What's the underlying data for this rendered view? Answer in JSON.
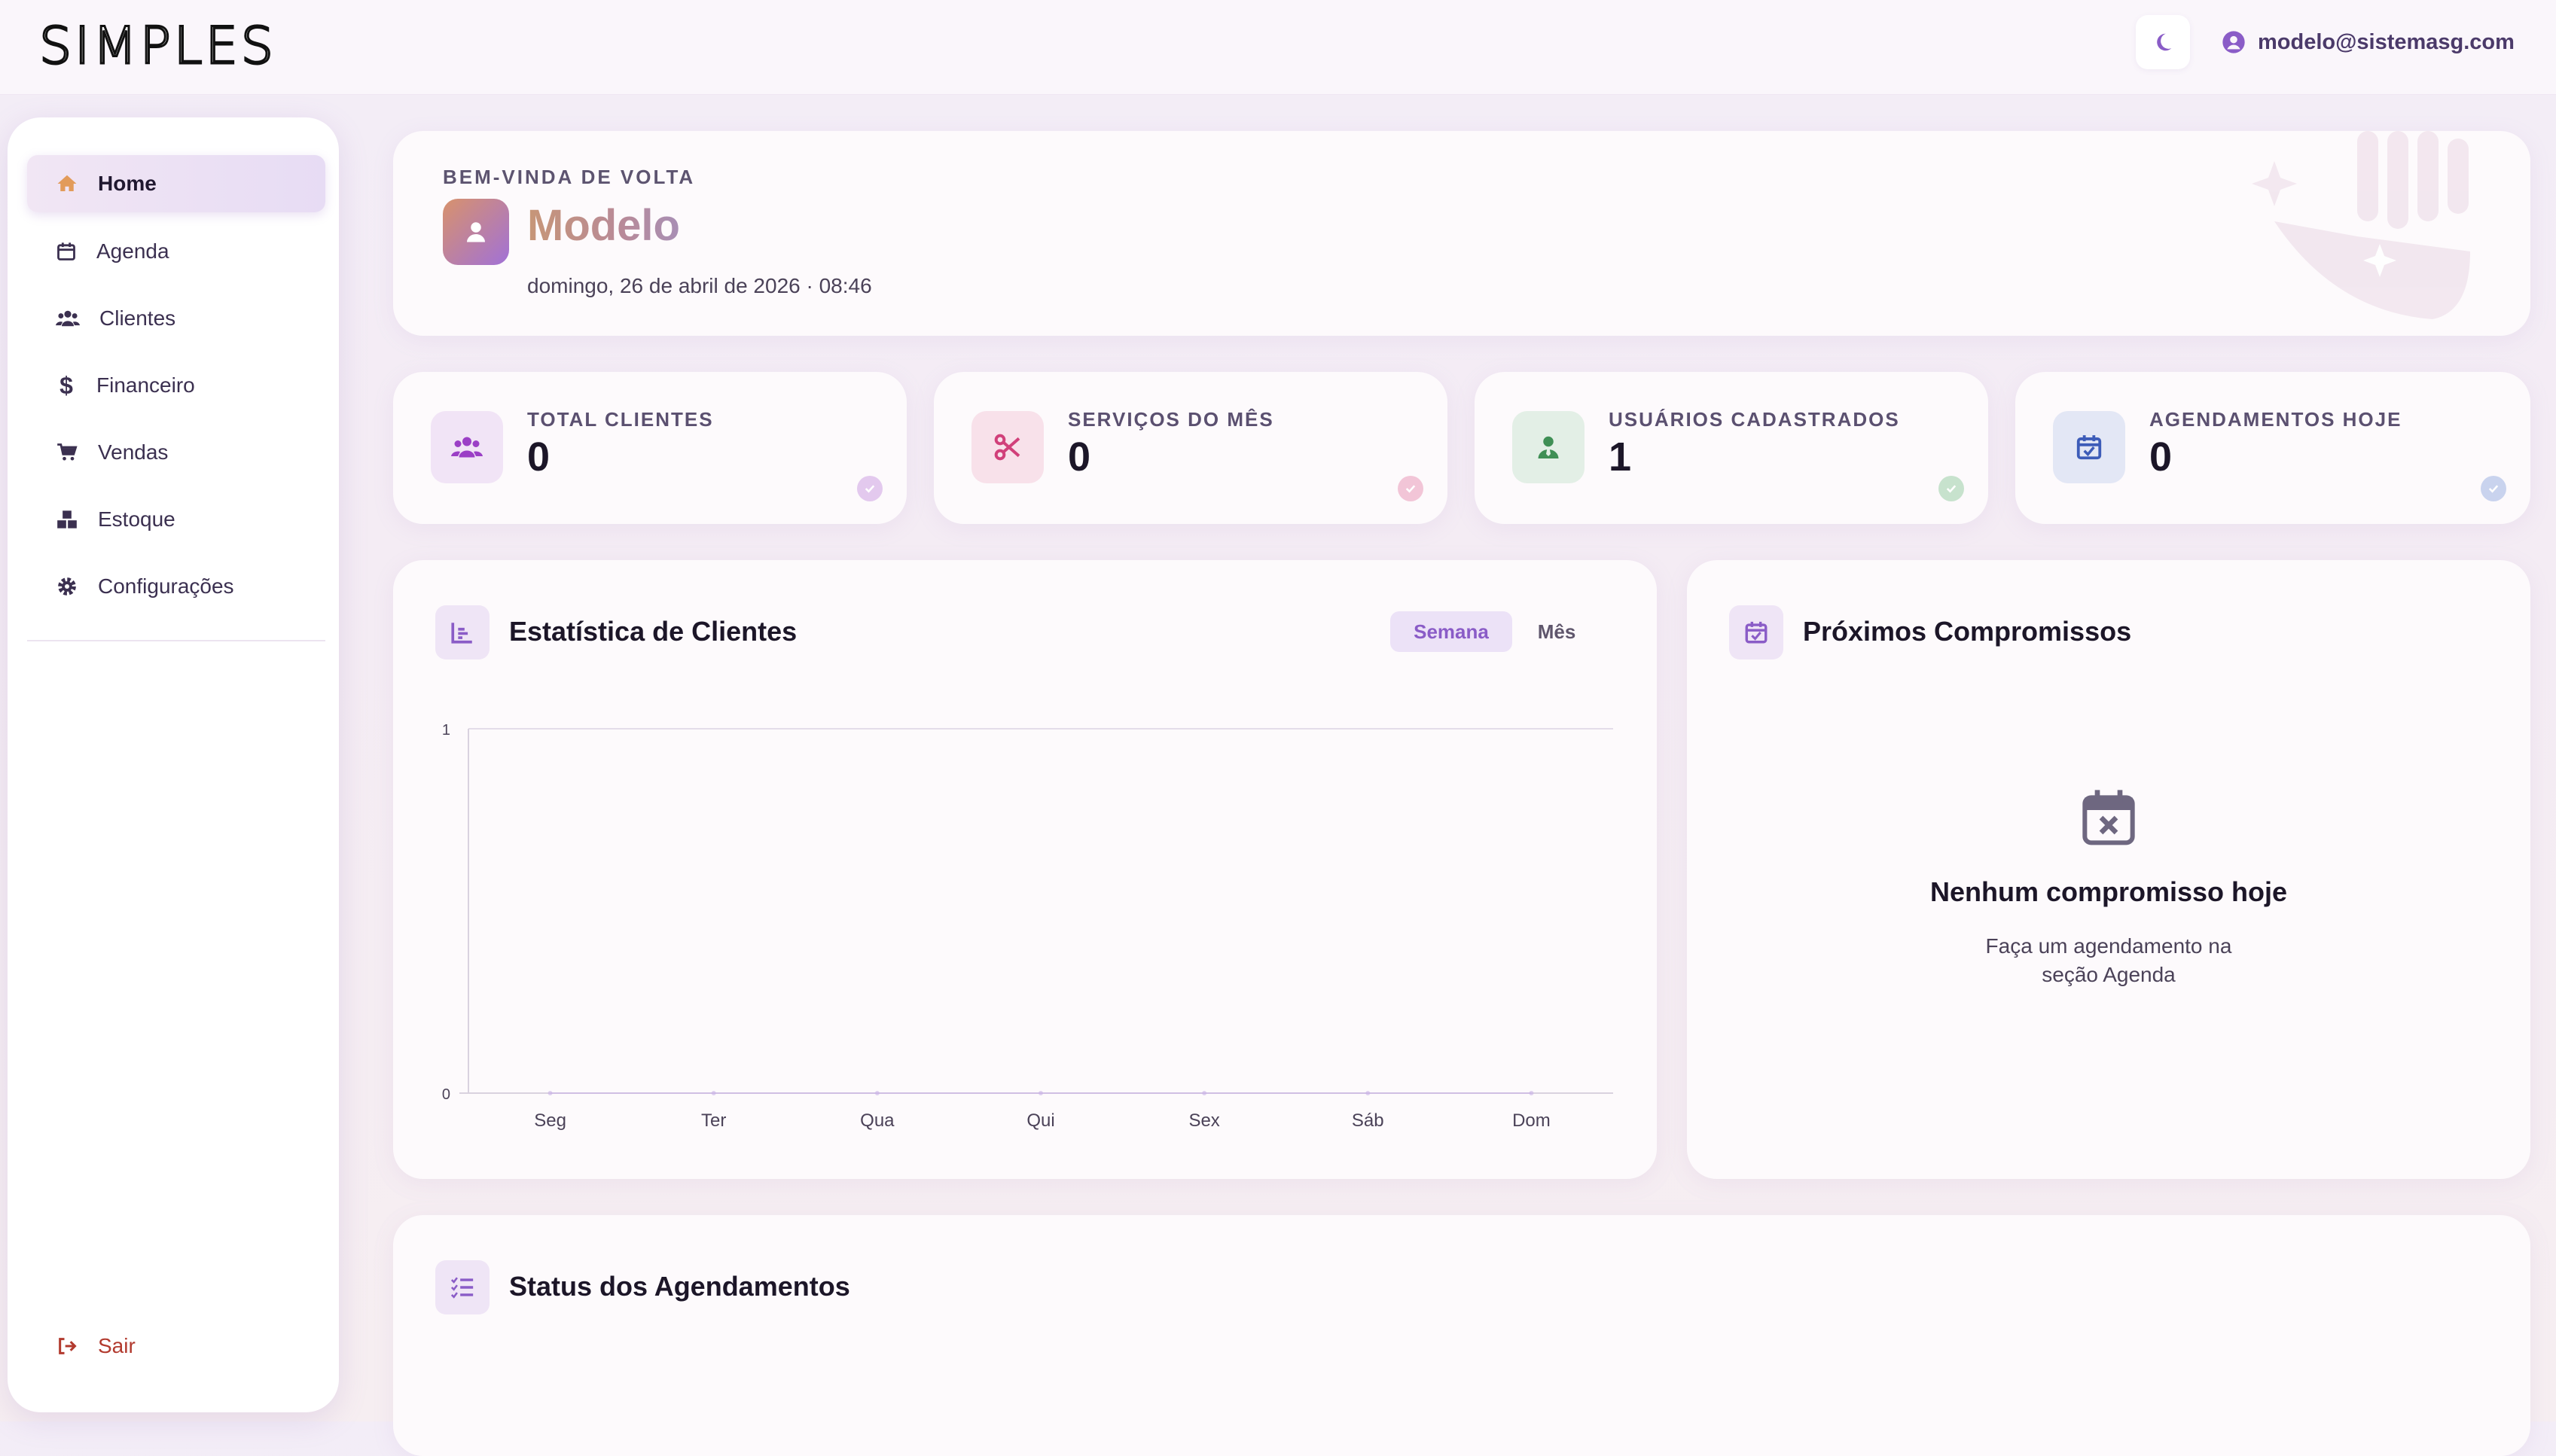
{
  "app": {
    "logo": "SIMPLES",
    "user_email": "modelo@sistemasg.com",
    "colors": {
      "accent": "#8a5cc7",
      "logout": "#b23a2e"
    }
  },
  "sidebar": {
    "items": [
      {
        "label": "Home",
        "icon": "home-icon",
        "active": true
      },
      {
        "label": "Agenda",
        "icon": "calendar-icon"
      },
      {
        "label": "Clientes",
        "icon": "users-icon"
      },
      {
        "label": "Financeiro",
        "icon": "dollar-icon"
      },
      {
        "label": "Vendas",
        "icon": "cart-icon"
      },
      {
        "label": "Estoque",
        "icon": "boxes-icon"
      },
      {
        "label": "Configurações",
        "icon": "gear-icon"
      }
    ],
    "logout_label": "Sair"
  },
  "welcome": {
    "kicker": "BEM-VINDA DE VOLTA",
    "name": "Modelo",
    "date": "domingo, 26 de abril de 2026 · 08:46"
  },
  "stats": [
    {
      "label": "TOTAL CLIENTES",
      "value": "0",
      "icon": "users-icon"
    },
    {
      "label": "SERVIÇOS DO MÊS",
      "value": "0",
      "icon": "scissors-icon"
    },
    {
      "label": "USUÁRIOS CADASTRADOS",
      "value": "1",
      "icon": "user-tie-icon"
    },
    {
      "label": "AGENDAMENTOS HOJE",
      "value": "0",
      "icon": "calendar-check-icon"
    }
  ],
  "client_stats": {
    "title": "Estatística de Clientes",
    "toggle": {
      "week": "Semana",
      "month": "Mês",
      "selected": "Semana"
    }
  },
  "chart_data": {
    "type": "line",
    "categories": [
      "Seg",
      "Ter",
      "Qua",
      "Qui",
      "Sex",
      "Sáb",
      "Dom"
    ],
    "ylim": [
      0,
      1
    ],
    "y_ticks": [
      "0",
      "1"
    ],
    "series": [
      {
        "values": [
          0,
          0,
          0,
          0,
          0,
          0,
          0
        ]
      }
    ],
    "grid": true
  },
  "appointments": {
    "title": "Próximos Compromissos",
    "empty_title": "Nenhum compromisso hoje",
    "empty_line1": "Faça um agendamento na",
    "empty_line2": "seção Agenda"
  },
  "status": {
    "title": "Status dos Agendamentos"
  }
}
